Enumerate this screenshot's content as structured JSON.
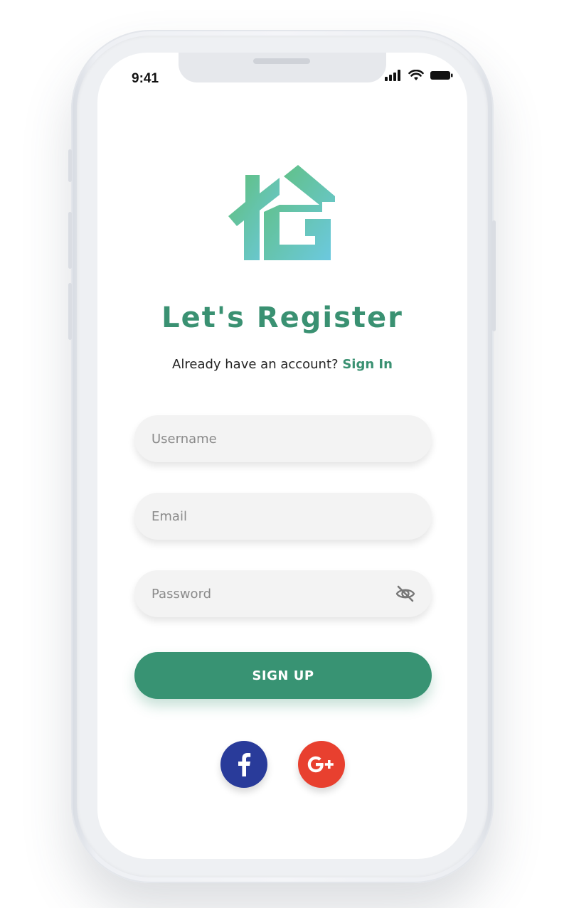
{
  "status_bar": {
    "time": "9:41",
    "icons": [
      "signal-icon",
      "wifi-icon",
      "battery-icon"
    ]
  },
  "logo": {
    "name": "ig-house-logo",
    "colors": [
      "#5fbf7a",
      "#6cc7dc"
    ]
  },
  "header": {
    "title": "Let's Register",
    "subtitle_prefix": "Already have an account?",
    "signin_link": "Sign In"
  },
  "form": {
    "username_placeholder": "Username",
    "email_placeholder": "Email",
    "password_placeholder": "Password",
    "password_toggle_icon": "eye-off-icon",
    "submit_label": "SIGN UP"
  },
  "social": {
    "facebook_glyph": "f",
    "google_glyph": "G+",
    "facebook_color": "#293b9a",
    "google_color": "#e8402f"
  },
  "colors": {
    "accent": "#389373",
    "title": "#3a9172"
  }
}
